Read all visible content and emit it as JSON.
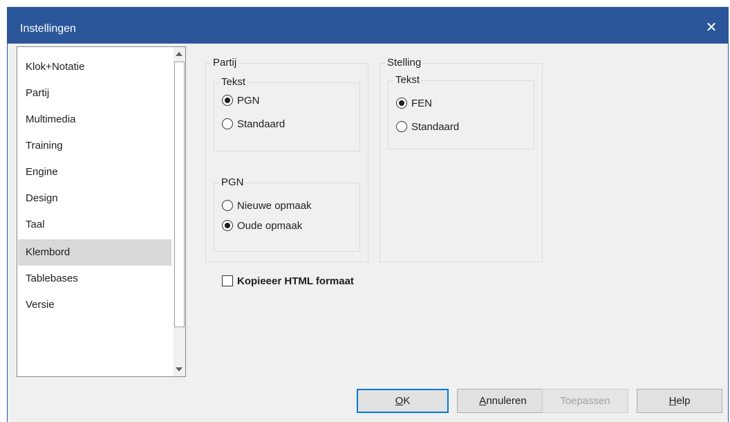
{
  "window": {
    "title": "Instellingen",
    "close_glyph": "✕"
  },
  "sidebar": {
    "items": [
      {
        "label": "Klok+Notatie",
        "selected": false
      },
      {
        "label": "Partij",
        "selected": false
      },
      {
        "label": "Multimedia",
        "selected": false
      },
      {
        "label": "Training",
        "selected": false
      },
      {
        "label": "Engine",
        "selected": false
      },
      {
        "label": "Design",
        "selected": false
      },
      {
        "label": "Taal",
        "selected": false
      },
      {
        "label": "Klembord",
        "selected": true
      },
      {
        "label": "Tablebases",
        "selected": false
      },
      {
        "label": "Versie",
        "selected": false
      }
    ]
  },
  "partij": {
    "title": "Partij",
    "tekst": {
      "title": "Tekst",
      "options": [
        {
          "label": "PGN",
          "checked": true
        },
        {
          "label": "Standaard",
          "checked": false
        }
      ]
    },
    "pgn": {
      "title": "PGN",
      "options": [
        {
          "label": "Nieuwe opmaak",
          "checked": false
        },
        {
          "label": "Oude opmaak",
          "checked": true
        }
      ]
    }
  },
  "stelling": {
    "title": "Stelling",
    "tekst": {
      "title": "Tekst",
      "options": [
        {
          "label": "FEN",
          "checked": true
        },
        {
          "label": "Standaard",
          "checked": false
        }
      ]
    }
  },
  "copy_html": {
    "label": "Kopieeer HTML formaat",
    "checked": false
  },
  "buttons": {
    "ok": {
      "mnemonic": "O",
      "rest": "K"
    },
    "cancel": {
      "mnemonic": "A",
      "rest": "nnuleren"
    },
    "apply": {
      "label": "Toepassen"
    },
    "help": {
      "mnemonic": "H",
      "rest": "elp"
    }
  },
  "colors": {
    "titlebar": "#2b579a",
    "selection": "#d9d9d9",
    "default_button_border": "#0078d7"
  }
}
